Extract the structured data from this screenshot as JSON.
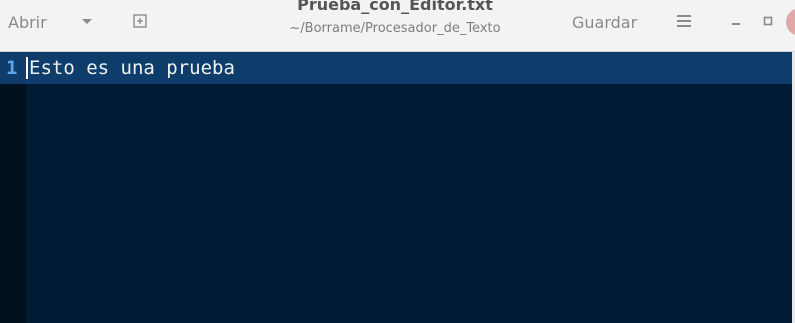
{
  "header": {
    "open_label": "Abrir",
    "title": "Prueba_con_Editor.txt",
    "path": "~/Borrame/Procesador_de_Texto",
    "save_label": "Guardar",
    "icons": {
      "open_menu": "chevron-down-icon",
      "new_tab": "new-document-icon",
      "menu": "hamburger-menu-icon",
      "minimize": "minimize-icon",
      "maximize": "maximize-icon"
    }
  },
  "editor": {
    "lines": [
      {
        "number": "1",
        "text": "Esto es una prueba"
      }
    ],
    "colors": {
      "background": "#001a33",
      "current_line": "#0e3d6b",
      "line_number": "#5ba8e6",
      "text": "#f0f0f0"
    }
  }
}
